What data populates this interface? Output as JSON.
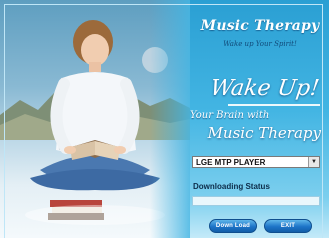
{
  "app": {
    "title": "Music Therapy",
    "tagline": "Wake up Your Spirit!"
  },
  "headline": {
    "wake": "Wake Up!",
    "line1": "Your Brain with",
    "line2": "Music Therapy"
  },
  "player_select": {
    "selected": "LGE MTP PLAYER"
  },
  "status": {
    "label": "Downloading Status",
    "progress": 0
  },
  "buttons": {
    "download": "Down Load",
    "exit": "EXIT"
  },
  "colors": {
    "accent": "#2a9fd3",
    "button": "#1d74c8"
  },
  "icons": {
    "dropdown": "chevron-down-icon"
  }
}
